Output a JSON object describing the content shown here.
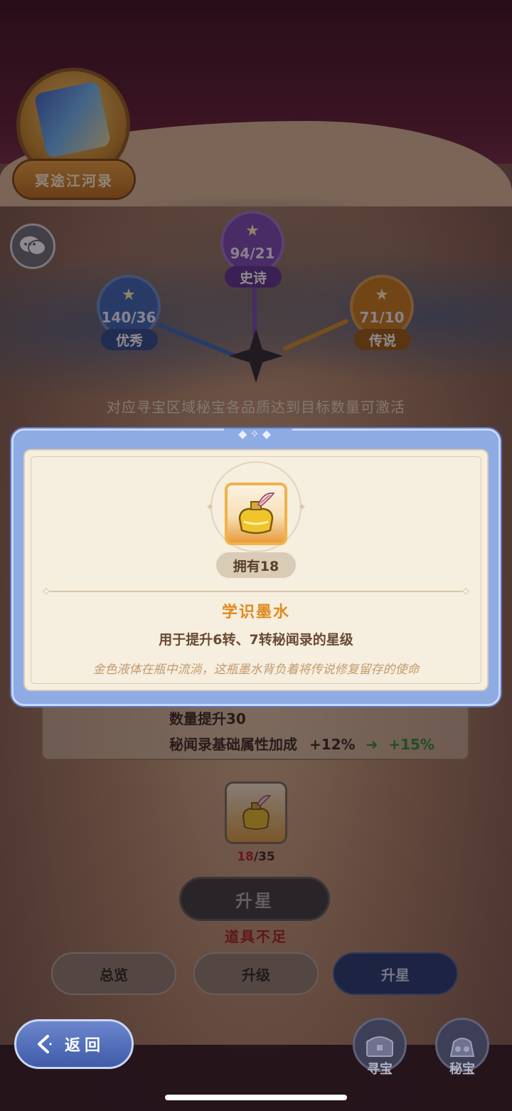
{
  "header": {
    "book_title": "冥途江河录"
  },
  "rarity_nodes": [
    {
      "label": "优秀",
      "progress": "140/36",
      "color": "#3a67b5"
    },
    {
      "label": "史诗",
      "progress": "94/21",
      "color": "#7a48b0"
    },
    {
      "label": "传说",
      "progress": "71/10",
      "color": "#c77a1a"
    }
  ],
  "hint_text": "对应寻宝区域秘宝各品质达到目标数量可激活",
  "upgrade_card": {
    "line1": "数量提升30",
    "bonus_label": "秘闻录基础属性加成",
    "bonus_from": "+12%",
    "bonus_to": "+15%"
  },
  "cost": {
    "have": "18",
    "need": "/35"
  },
  "upstar_button": "升星",
  "insufficient_text": "道具不足",
  "tabs": [
    {
      "label": "总览",
      "active": false
    },
    {
      "label": "升级",
      "active": false
    },
    {
      "label": "升星",
      "active": true
    }
  ],
  "back_button": "返回",
  "bottom_nav": [
    {
      "label": "寻宝",
      "icon": "treasure-chest-icon"
    },
    {
      "label": "秘宝",
      "icon": "treasure-bag-icon"
    }
  ],
  "modal": {
    "own_label": "拥有18",
    "item_name": "学识墨水",
    "item_use": "用于提升6转、7转秘闻录的星级",
    "item_lore": "金色液体在瓶中流淌，这瓶墨水背负着将传说修复留存的使命",
    "item_icon": "ink-bottle-icon"
  }
}
